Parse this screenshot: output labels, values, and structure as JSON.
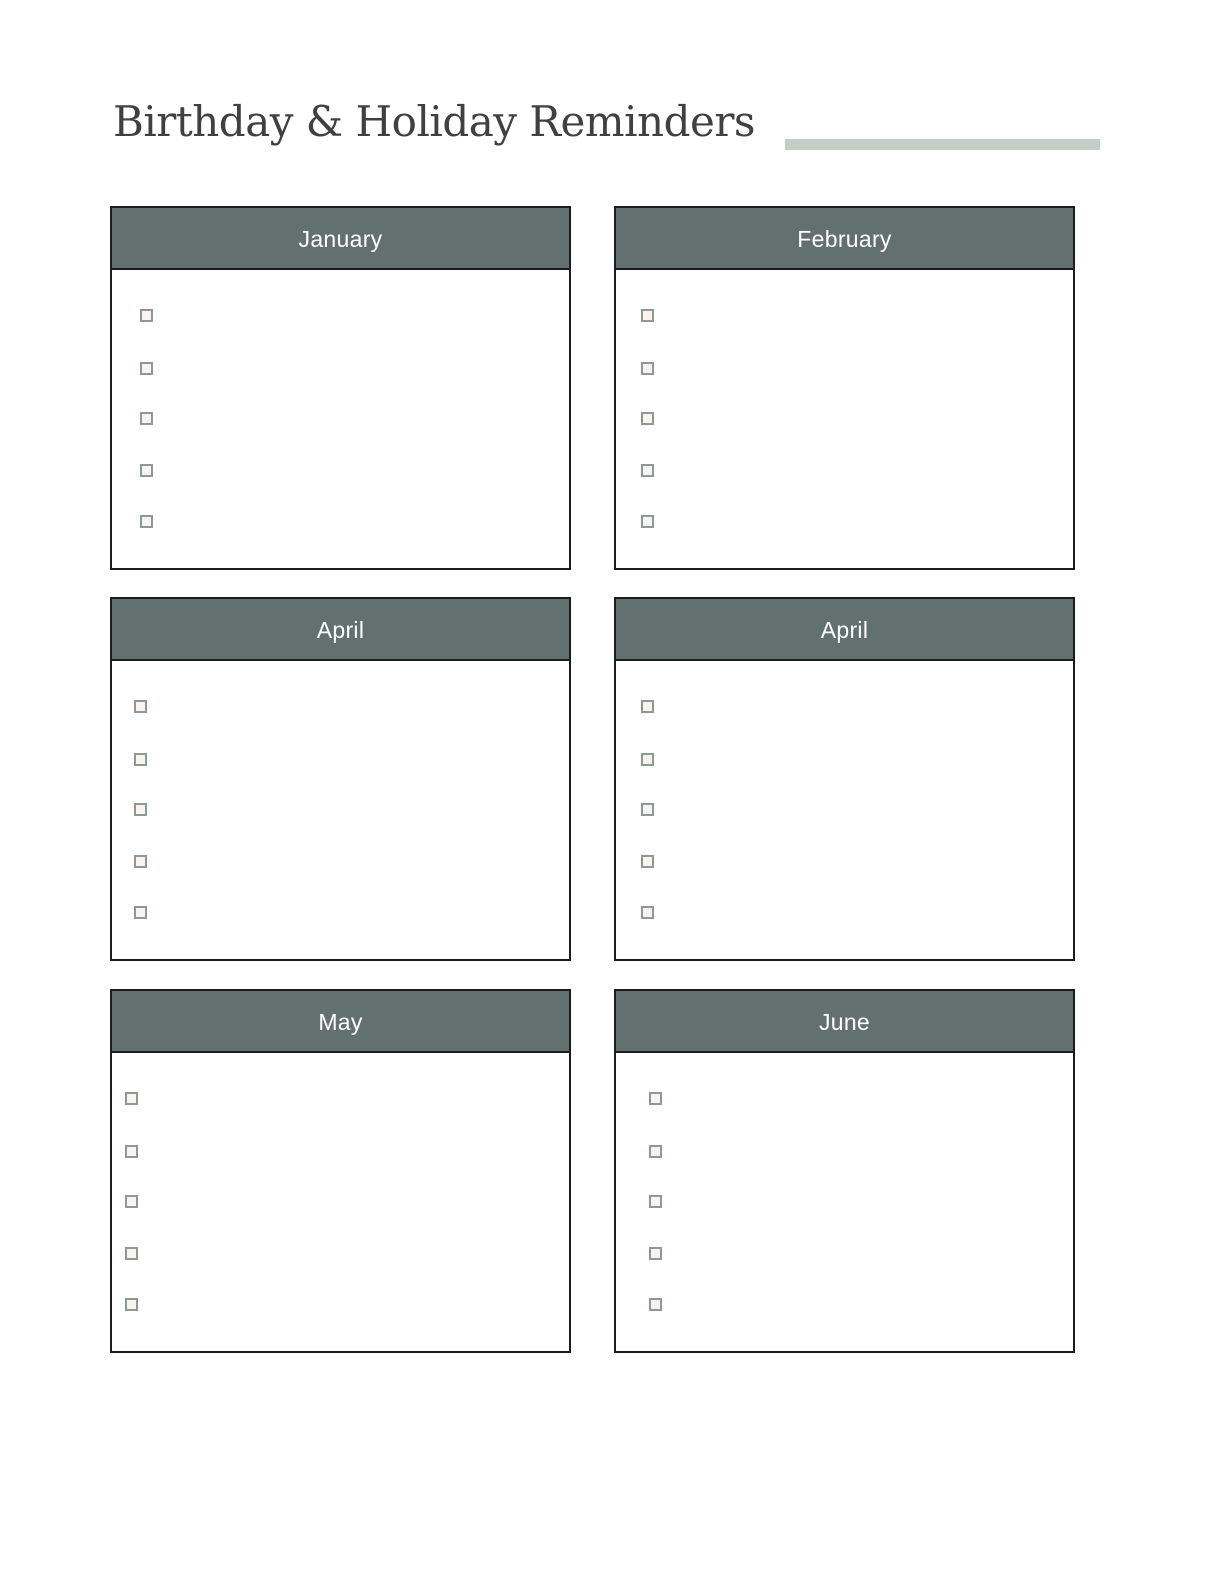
{
  "title": "Birthday & Holiday Reminders",
  "colors": {
    "header_bg": "#627170",
    "accent_bar": "#c4cec6",
    "title_text": "#404040",
    "checkbox_border": "#8d9999"
  },
  "months": [
    {
      "label": "January",
      "items": [
        {
          "checked": false
        },
        {
          "checked": false
        },
        {
          "checked": false
        },
        {
          "checked": false
        },
        {
          "checked": false
        }
      ]
    },
    {
      "label": "February",
      "items": [
        {
          "checked": false
        },
        {
          "checked": false
        },
        {
          "checked": false
        },
        {
          "checked": false
        },
        {
          "checked": false
        }
      ]
    },
    {
      "label": "April",
      "items": [
        {
          "checked": false
        },
        {
          "checked": false
        },
        {
          "checked": false
        },
        {
          "checked": false
        },
        {
          "checked": false
        }
      ]
    },
    {
      "label": "April",
      "items": [
        {
          "checked": false
        },
        {
          "checked": false
        },
        {
          "checked": false
        },
        {
          "checked": false
        },
        {
          "checked": false
        }
      ]
    },
    {
      "label": "May",
      "items": [
        {
          "checked": false
        },
        {
          "checked": false
        },
        {
          "checked": false
        },
        {
          "checked": false
        },
        {
          "checked": false
        }
      ]
    },
    {
      "label": "June",
      "items": [
        {
          "checked": false
        },
        {
          "checked": false
        },
        {
          "checked": false
        },
        {
          "checked": false
        },
        {
          "checked": false
        }
      ]
    }
  ]
}
